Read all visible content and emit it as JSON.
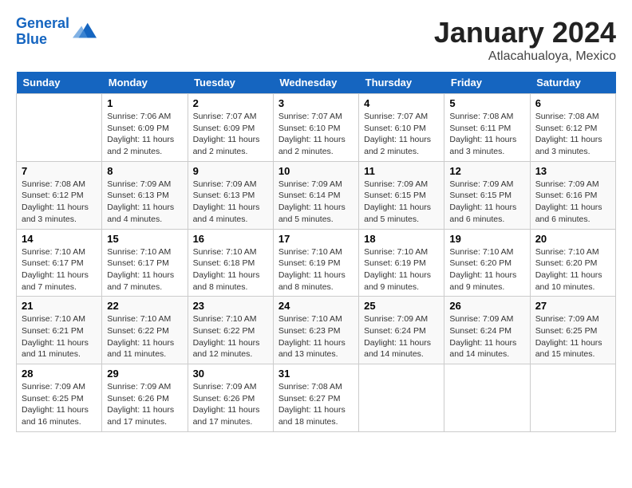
{
  "header": {
    "logo_line1": "General",
    "logo_line2": "Blue",
    "month": "January 2024",
    "location": "Atlacahualoya, Mexico"
  },
  "weekdays": [
    "Sunday",
    "Monday",
    "Tuesday",
    "Wednesday",
    "Thursday",
    "Friday",
    "Saturday"
  ],
  "weeks": [
    [
      {
        "day": "",
        "info": ""
      },
      {
        "day": "1",
        "info": "Sunrise: 7:06 AM\nSunset: 6:09 PM\nDaylight: 11 hours and 2 minutes."
      },
      {
        "day": "2",
        "info": "Sunrise: 7:07 AM\nSunset: 6:09 PM\nDaylight: 11 hours and 2 minutes."
      },
      {
        "day": "3",
        "info": "Sunrise: 7:07 AM\nSunset: 6:10 PM\nDaylight: 11 hours and 2 minutes."
      },
      {
        "day": "4",
        "info": "Sunrise: 7:07 AM\nSunset: 6:10 PM\nDaylight: 11 hours and 2 minutes."
      },
      {
        "day": "5",
        "info": "Sunrise: 7:08 AM\nSunset: 6:11 PM\nDaylight: 11 hours and 3 minutes."
      },
      {
        "day": "6",
        "info": "Sunrise: 7:08 AM\nSunset: 6:12 PM\nDaylight: 11 hours and 3 minutes."
      }
    ],
    [
      {
        "day": "7",
        "info": "Sunrise: 7:08 AM\nSunset: 6:12 PM\nDaylight: 11 hours and 3 minutes."
      },
      {
        "day": "8",
        "info": "Sunrise: 7:09 AM\nSunset: 6:13 PM\nDaylight: 11 hours and 4 minutes."
      },
      {
        "day": "9",
        "info": "Sunrise: 7:09 AM\nSunset: 6:13 PM\nDaylight: 11 hours and 4 minutes."
      },
      {
        "day": "10",
        "info": "Sunrise: 7:09 AM\nSunset: 6:14 PM\nDaylight: 11 hours and 5 minutes."
      },
      {
        "day": "11",
        "info": "Sunrise: 7:09 AM\nSunset: 6:15 PM\nDaylight: 11 hours and 5 minutes."
      },
      {
        "day": "12",
        "info": "Sunrise: 7:09 AM\nSunset: 6:15 PM\nDaylight: 11 hours and 6 minutes."
      },
      {
        "day": "13",
        "info": "Sunrise: 7:09 AM\nSunset: 6:16 PM\nDaylight: 11 hours and 6 minutes."
      }
    ],
    [
      {
        "day": "14",
        "info": "Sunrise: 7:10 AM\nSunset: 6:17 PM\nDaylight: 11 hours and 7 minutes."
      },
      {
        "day": "15",
        "info": "Sunrise: 7:10 AM\nSunset: 6:17 PM\nDaylight: 11 hours and 7 minutes."
      },
      {
        "day": "16",
        "info": "Sunrise: 7:10 AM\nSunset: 6:18 PM\nDaylight: 11 hours and 8 minutes."
      },
      {
        "day": "17",
        "info": "Sunrise: 7:10 AM\nSunset: 6:19 PM\nDaylight: 11 hours and 8 minutes."
      },
      {
        "day": "18",
        "info": "Sunrise: 7:10 AM\nSunset: 6:19 PM\nDaylight: 11 hours and 9 minutes."
      },
      {
        "day": "19",
        "info": "Sunrise: 7:10 AM\nSunset: 6:20 PM\nDaylight: 11 hours and 9 minutes."
      },
      {
        "day": "20",
        "info": "Sunrise: 7:10 AM\nSunset: 6:20 PM\nDaylight: 11 hours and 10 minutes."
      }
    ],
    [
      {
        "day": "21",
        "info": "Sunrise: 7:10 AM\nSunset: 6:21 PM\nDaylight: 11 hours and 11 minutes."
      },
      {
        "day": "22",
        "info": "Sunrise: 7:10 AM\nSunset: 6:22 PM\nDaylight: 11 hours and 11 minutes."
      },
      {
        "day": "23",
        "info": "Sunrise: 7:10 AM\nSunset: 6:22 PM\nDaylight: 11 hours and 12 minutes."
      },
      {
        "day": "24",
        "info": "Sunrise: 7:10 AM\nSunset: 6:23 PM\nDaylight: 11 hours and 13 minutes."
      },
      {
        "day": "25",
        "info": "Sunrise: 7:09 AM\nSunset: 6:24 PM\nDaylight: 11 hours and 14 minutes."
      },
      {
        "day": "26",
        "info": "Sunrise: 7:09 AM\nSunset: 6:24 PM\nDaylight: 11 hours and 14 minutes."
      },
      {
        "day": "27",
        "info": "Sunrise: 7:09 AM\nSunset: 6:25 PM\nDaylight: 11 hours and 15 minutes."
      }
    ],
    [
      {
        "day": "28",
        "info": "Sunrise: 7:09 AM\nSunset: 6:25 PM\nDaylight: 11 hours and 16 minutes."
      },
      {
        "day": "29",
        "info": "Sunrise: 7:09 AM\nSunset: 6:26 PM\nDaylight: 11 hours and 17 minutes."
      },
      {
        "day": "30",
        "info": "Sunrise: 7:09 AM\nSunset: 6:26 PM\nDaylight: 11 hours and 17 minutes."
      },
      {
        "day": "31",
        "info": "Sunrise: 7:08 AM\nSunset: 6:27 PM\nDaylight: 11 hours and 18 minutes."
      },
      {
        "day": "",
        "info": ""
      },
      {
        "day": "",
        "info": ""
      },
      {
        "day": "",
        "info": ""
      }
    ]
  ]
}
